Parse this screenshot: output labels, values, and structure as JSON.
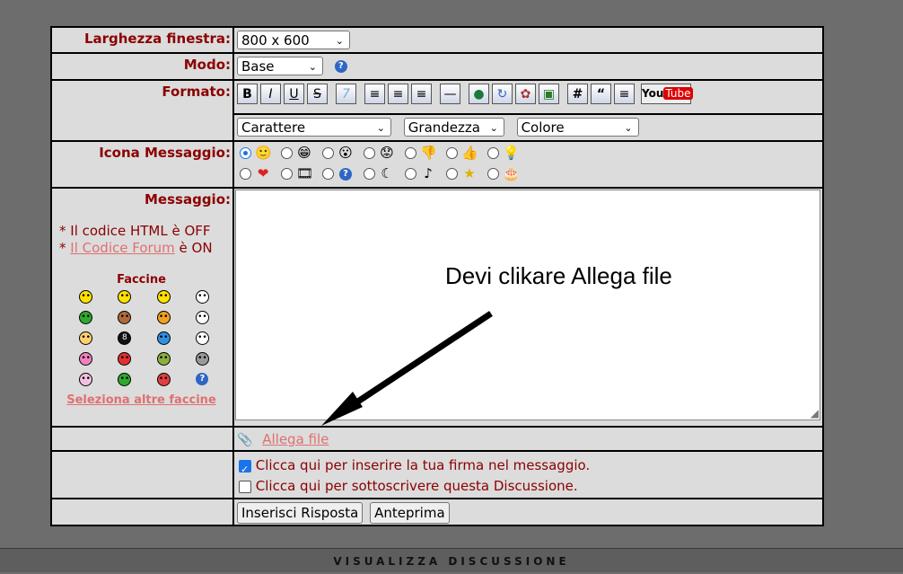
{
  "rows": {
    "larghezza": {
      "label": "Larghezza finestra:",
      "value": "800 x 600"
    },
    "modo": {
      "label": "Modo:",
      "value": "Base"
    },
    "formato": {
      "label": "Formato:",
      "font": "Carattere",
      "size": "Grandezza",
      "color": "Colore"
    },
    "icona": {
      "label": "Icona Messaggio:"
    },
    "messaggio": {
      "label": "Messaggio:",
      "html_off": "* Il codice HTML è OFF",
      "forum_prefix": "* ",
      "forum_link": "Il Codice Forum",
      "forum_suffix": " è ON",
      "faccine_title": "Faccine",
      "altre_faccine": "Seleziona altre faccine"
    },
    "allega": {
      "label": "Allega file"
    },
    "firma": {
      "label": "Clicca qui per inserire la tua firma nel messaggio.",
      "checked": true
    },
    "sottoscrivi": {
      "label": "Clicca qui per sottoscrivere questa Discussione.",
      "checked": false
    },
    "submit": {
      "label": "Inserisci Risposta"
    },
    "preview": {
      "label": "Anteprima"
    }
  },
  "annotation": "Devi clikare Allega file",
  "footer": "VISUALIZZA DISCUSSIONE",
  "toolbar": {
    "youtube_you": "You",
    "youtube_tube": "Tube",
    "buttons": [
      "bold-icon",
      "italic-icon",
      "underline-icon",
      "strikethrough-icon",
      "quote-7-icon",
      "align-left-icon",
      "align-center-icon",
      "align-right-icon",
      "horizontal-rule-icon",
      "globe-icon",
      "image-link-icon",
      "film-reel-icon",
      "picture-icon",
      "hash-icon",
      "blockquote-icon",
      "list-icon"
    ]
  }
}
